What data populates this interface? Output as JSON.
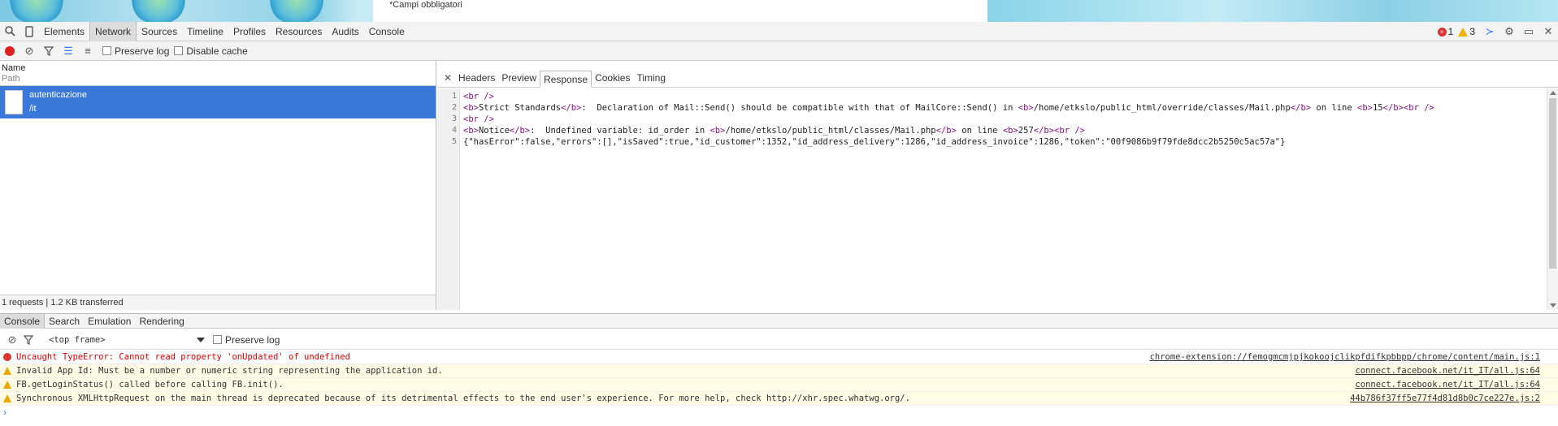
{
  "page": {
    "form_note": "*Campi obbligatori"
  },
  "toolbar": {
    "tabs": [
      "Elements",
      "Network",
      "Sources",
      "Timeline",
      "Profiles",
      "Resources",
      "Audits",
      "Console"
    ],
    "active_tab": "Network",
    "error_count": "1",
    "warning_count": "3"
  },
  "network_toolbar": {
    "preserve_log": "Preserve log",
    "disable_cache": "Disable cache"
  },
  "request_list": {
    "header_name": "Name",
    "header_path": "Path",
    "items": [
      {
        "name": "autenticazione",
        "path": "/it"
      }
    ],
    "status": "1 requests | 1.2 KB transferred"
  },
  "detail_tabs": [
    "Headers",
    "Preview",
    "Response",
    "Cookies",
    "Timing"
  ],
  "active_detail_tab": "Response",
  "response_lines": [
    {
      "n": "1",
      "html": "<span class='tag'>&lt;br /&gt;</span>"
    },
    {
      "n": "2",
      "html": "<span class='tag'>&lt;b&gt;</span>Strict Standards<span class='tag'>&lt;/b&gt;</span>:  Declaration of Mail::Send() should be compatible with that of MailCore::Send() in <span class='tag'>&lt;b&gt;</span>/home/etkslo/public_html/override/classes/Mail.php<span class='tag'>&lt;/b&gt;</span> on line <span class='tag'>&lt;b&gt;</span>15<span class='tag'>&lt;/b&gt;&lt;br /&gt;</span>"
    },
    {
      "n": "3",
      "html": "<span class='tag'>&lt;br /&gt;</span>"
    },
    {
      "n": "4",
      "html": "<span class='tag'>&lt;b&gt;</span>Notice<span class='tag'>&lt;/b&gt;</span>:  Undefined variable: id_order in <span class='tag'>&lt;b&gt;</span>/home/etkslo/public_html/classes/Mail.php<span class='tag'>&lt;/b&gt;</span> on line <span class='tag'>&lt;b&gt;</span>257<span class='tag'>&lt;/b&gt;&lt;br /&gt;</span>"
    },
    {
      "n": "5",
      "html": "{\"hasError\":false,\"errors\":[],\"isSaved\":true,\"id_customer\":1352,\"id_address_delivery\":1286,\"id_address_invoice\":1286,\"token\":\"00f9086b9f79fde8dcc2b5250c5ac57a\"}"
    }
  ],
  "drawer_tabs": [
    "Console",
    "Search",
    "Emulation",
    "Rendering"
  ],
  "console_toolbar": {
    "frame": "<top frame>",
    "preserve_log": "Preserve log"
  },
  "console_messages": [
    {
      "level": "error",
      "text": "Uncaught TypeError: Cannot read property 'onUpdated' of undefined",
      "source": "chrome-extension://femogmcmjpjkokoojclikpfdifkpbbpp/chrome/content/main.js:1"
    },
    {
      "level": "warn",
      "text": "Invalid App Id: Must be a number or numeric string representing the application id.",
      "source": "connect.facebook.net/it_IT/all.js:64"
    },
    {
      "level": "warn",
      "text": "FB.getLoginStatus() called before calling FB.init().",
      "source": "connect.facebook.net/it_IT/all.js:64"
    },
    {
      "level": "warn",
      "text": "Synchronous XMLHttpRequest on the main thread is deprecated because of its detrimental effects to the end user's experience. For more help, check http://xhr.spec.whatwg.org/.",
      "source": "44b786f37ff5e77f4d81d8b0c7ce227e.js:2"
    }
  ],
  "colors": {
    "selected_row": "#3879d9",
    "error": "#d00000",
    "warning": "#e8a800",
    "tag": "#881280"
  }
}
